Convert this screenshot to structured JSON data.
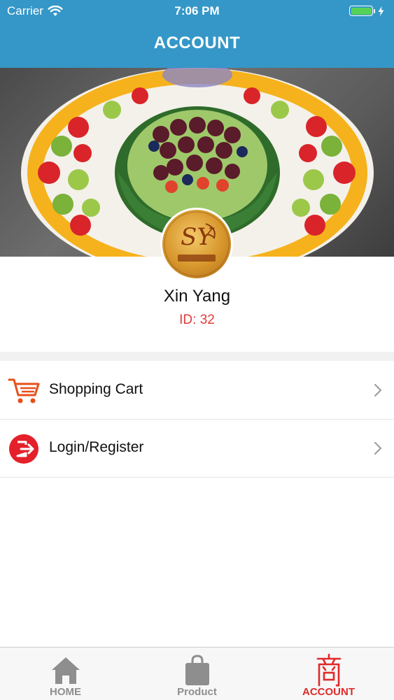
{
  "status_bar": {
    "carrier": "Carrier",
    "time": "7:06 PM"
  },
  "header": {
    "title": "ACCOUNT"
  },
  "profile": {
    "name": "Xin Yang",
    "id_text": "ID: 32"
  },
  "menu": [
    {
      "label": "Shopping Cart",
      "icon": "shopping-cart-icon"
    },
    {
      "label": "Login/Register",
      "icon": "login-exit-icon"
    }
  ],
  "tabbar": [
    {
      "label": "HOME",
      "icon": "home-icon",
      "active": false
    },
    {
      "label": "Product",
      "icon": "shopping-bag-icon",
      "active": false
    },
    {
      "label": "ACCOUNT",
      "icon": "shop-character-icon",
      "active": true
    }
  ],
  "colors": {
    "nav_bar": "#3497c8",
    "accent_red": "#e02a2a",
    "id_red": "#e23a3a",
    "battery_green": "#56d15a"
  }
}
